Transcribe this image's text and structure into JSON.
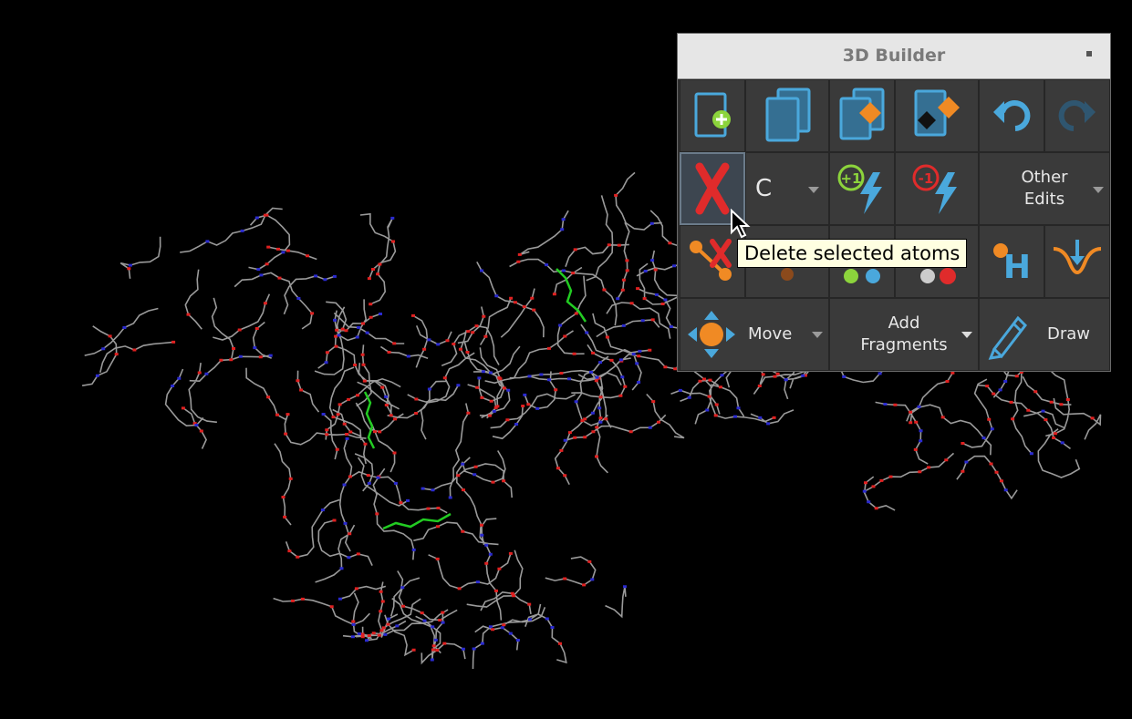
{
  "panel": {
    "title": "3D Builder",
    "tooltip": "Delete selected atoms",
    "element_value": "C",
    "buttons": {
      "other_edits": "Other\nEdits",
      "move": "Move",
      "add_fragments": "Add\nFragments",
      "draw": "Draw"
    },
    "icons": {
      "row1": [
        "new-entry-icon",
        "duplicate-entry-icon",
        "copy-fragment-icon",
        "replace-fragment-icon",
        "undo-icon",
        "redo-icon"
      ],
      "row2": [
        "delete-atoms-icon",
        "increase-charge-icon",
        "decrease-charge-icon"
      ],
      "row3": [
        "delete-bond-icon",
        "add-hydrogens-icon",
        "minimize-icon"
      ],
      "row4": [
        "move-icon",
        "draw-pencil-icon"
      ]
    },
    "colors": {
      "accent_blue": "#4aa8dc",
      "accent_orange": "#f08a24",
      "delete_red": "#e02b2b",
      "green": "#8cd43c",
      "panel_bg": "#2f2f2f"
    }
  },
  "viewport": {
    "atom_colors": {
      "carbon": "#9a9a9a",
      "oxygen": "#e02020",
      "nitrogen": "#2a2ad0",
      "ligand": "#22cc22"
    }
  }
}
